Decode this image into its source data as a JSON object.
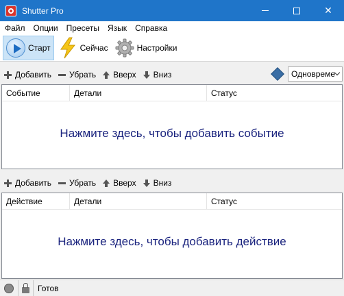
{
  "window": {
    "title": "Shutter Pro"
  },
  "menu": [
    "Файл",
    "Опции",
    "Пресеты",
    "Язык",
    "Справка"
  ],
  "toolbar": {
    "start": "Старт",
    "now": "Сейчас",
    "settings": "Настройки"
  },
  "events": {
    "add": "Добавить",
    "remove": "Убрать",
    "up": "Вверх",
    "down": "Вниз",
    "mode": "Одновреме",
    "columns": [
      "Событие",
      "Детали",
      "Статус"
    ],
    "empty": "Нажмите здесь, чтобы добавить событие"
  },
  "actions": {
    "add": "Добавить",
    "remove": "Убрать",
    "up": "Вверх",
    "down": "Вниз",
    "columns": [
      "Действие",
      "Детали",
      "Статус"
    ],
    "empty": "Нажмите здесь, чтобы добавить действие"
  },
  "status": {
    "text": "Готов"
  },
  "colors": {
    "titlebar": "#1f75c9",
    "empty_text": "#1a237e"
  }
}
